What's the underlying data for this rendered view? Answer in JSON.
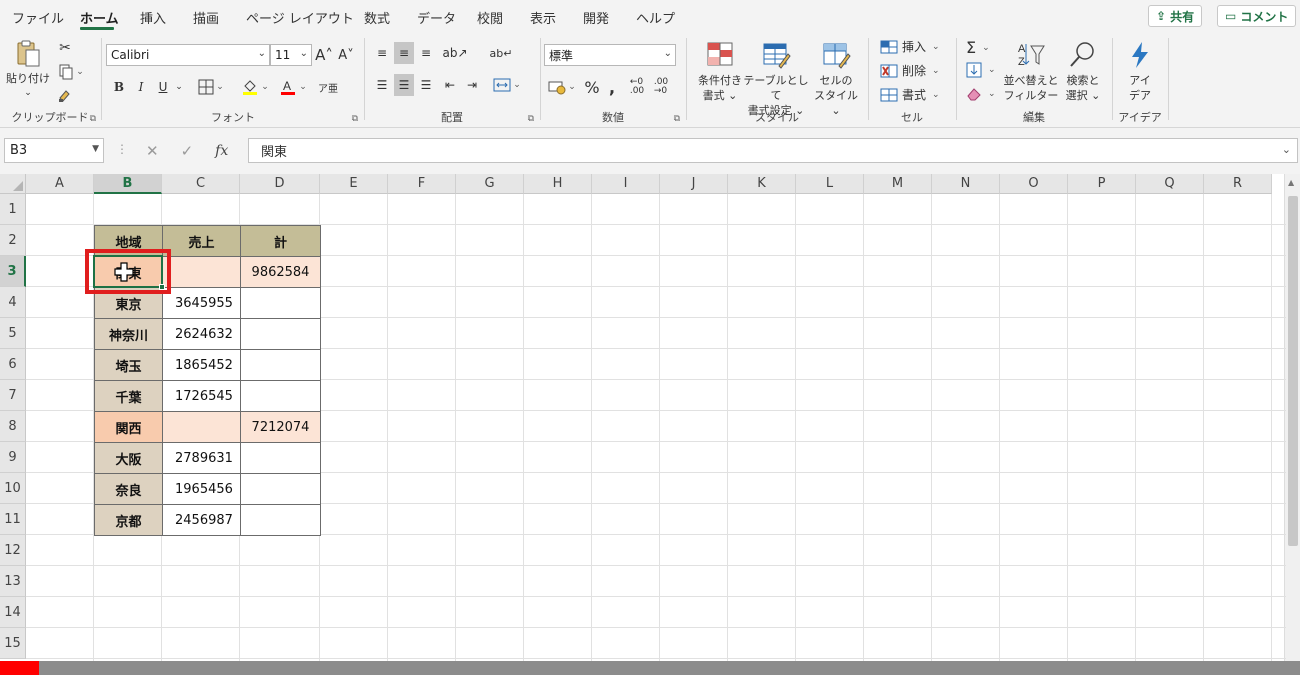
{
  "tabs": [
    "ファイル",
    "ホーム",
    "挿入",
    "描画",
    "ページ レイアウト",
    "数式",
    "データ",
    "校閲",
    "表示",
    "開発",
    "ヘルプ"
  ],
  "share_label": "共有",
  "comment_label": "コメント",
  "ribbon": {
    "clipboard": {
      "label": "クリップボード",
      "paste": "貼り付け"
    },
    "font": {
      "label": "フォント",
      "font_name": "Calibri",
      "font_size": "11",
      "bold": "B",
      "italic": "I",
      "underline": "U"
    },
    "alignment": {
      "label": "配置"
    },
    "number": {
      "label": "数値",
      "format": "標準"
    },
    "styles": {
      "label": "スタイル",
      "conditional": [
        "条件付き",
        "書式"
      ],
      "table": [
        "テーブルとして",
        "書式設定"
      ],
      "cellstyle": [
        "セルの",
        "スタイル"
      ]
    },
    "cells": {
      "label": "セル",
      "insert": "挿入",
      "delete": "削除",
      "format": "書式"
    },
    "editing": {
      "label": "編集",
      "sort": [
        "並べ替えと",
        "フィルター"
      ],
      "find": [
        "検索と",
        "選択"
      ]
    },
    "ideas": {
      "label": "アイデア",
      "button": [
        "アイ",
        "デア"
      ]
    }
  },
  "formula_bar": {
    "name_box": "B3",
    "content": "関東"
  },
  "columns": [
    "A",
    "B",
    "C",
    "D",
    "E",
    "F",
    "G",
    "H",
    "I",
    "J",
    "K",
    "L",
    "M",
    "N",
    "O",
    "P",
    "Q",
    "R"
  ],
  "selected_column": "B",
  "rows": [
    "1",
    "2",
    "3",
    "4",
    "5",
    "6",
    "7",
    "8",
    "9",
    "10",
    "11",
    "12",
    "13",
    "14",
    "15"
  ],
  "selected_row": "3",
  "table": {
    "headers": [
      "地域",
      "売上",
      "計"
    ],
    "rows": [
      {
        "region": "関東",
        "sales": "",
        "total": "9862584",
        "type": "group"
      },
      {
        "region": "東京",
        "sales": "3645955",
        "total": "",
        "type": "item"
      },
      {
        "region": "神奈川",
        "sales": "2624632",
        "total": "",
        "type": "item"
      },
      {
        "region": "埼玉",
        "sales": "1865452",
        "total": "",
        "type": "item"
      },
      {
        "region": "千葉",
        "sales": "1726545",
        "total": "",
        "type": "item"
      },
      {
        "region": "関西",
        "sales": "",
        "total": "7212074",
        "type": "group"
      },
      {
        "region": "大阪",
        "sales": "2789631",
        "total": "",
        "type": "item"
      },
      {
        "region": "奈良",
        "sales": "1965456",
        "total": "",
        "type": "item"
      },
      {
        "region": "京都",
        "sales": "2456987",
        "total": "",
        "type": "item"
      }
    ]
  },
  "colors": {
    "header_fill": "#c4bd97",
    "group_region_fill": "#f8cbad",
    "group_other_fill": "#fce4d6",
    "item_region_fill": "#ddd2c0",
    "selection": "#1e7145",
    "highlight_box": "#e01e1e"
  },
  "video_progress": 0.03
}
